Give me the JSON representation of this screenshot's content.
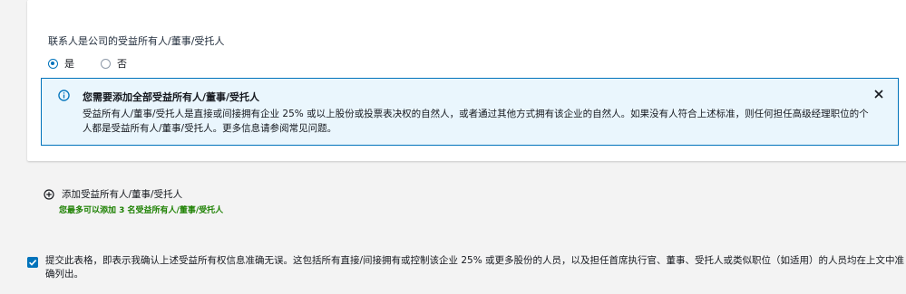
{
  "ownership_section": {
    "question": "联系人是公司的受益所有人/董事/受托人",
    "options": [
      {
        "label": "是",
        "selected": true
      },
      {
        "label": "否",
        "selected": false
      }
    ]
  },
  "info_alert": {
    "icon": "info-icon",
    "title": "您需要添加全部受益所有人/董事/受托人",
    "body": "受益所有人/董事/受托人是直接或间接拥有企业 25% 或以上股份或投票表决权的自然人，或者通过其他方式拥有该企业的自然人。如果没有人符合上述标准，则任何担任高级经理职位的个人都是受益所有人/董事/受托人。更多信息请参阅常见问题。",
    "close_icon": "close-icon"
  },
  "add_owner": {
    "icon": "plus-circle-icon",
    "label": "添加受益所有人/董事/受托人",
    "limit_note": "您最多可以添加 3 名受益所有人/董事/受托人"
  },
  "acknowledgement": {
    "checked": true,
    "text": "提交此表格，即表示我确认上述受益所有权信息准确无误。这包括所有直接/间接拥有或控制该企业 25% 或更多股份的人员，以及担任首席执行官、董事、受托人或类似职位（如适用）的人员均在上文中准确列出。"
  },
  "colors": {
    "accent": "#0073bb",
    "alert_bg": "#eaf6fd",
    "limit_text": "#1d8102"
  }
}
